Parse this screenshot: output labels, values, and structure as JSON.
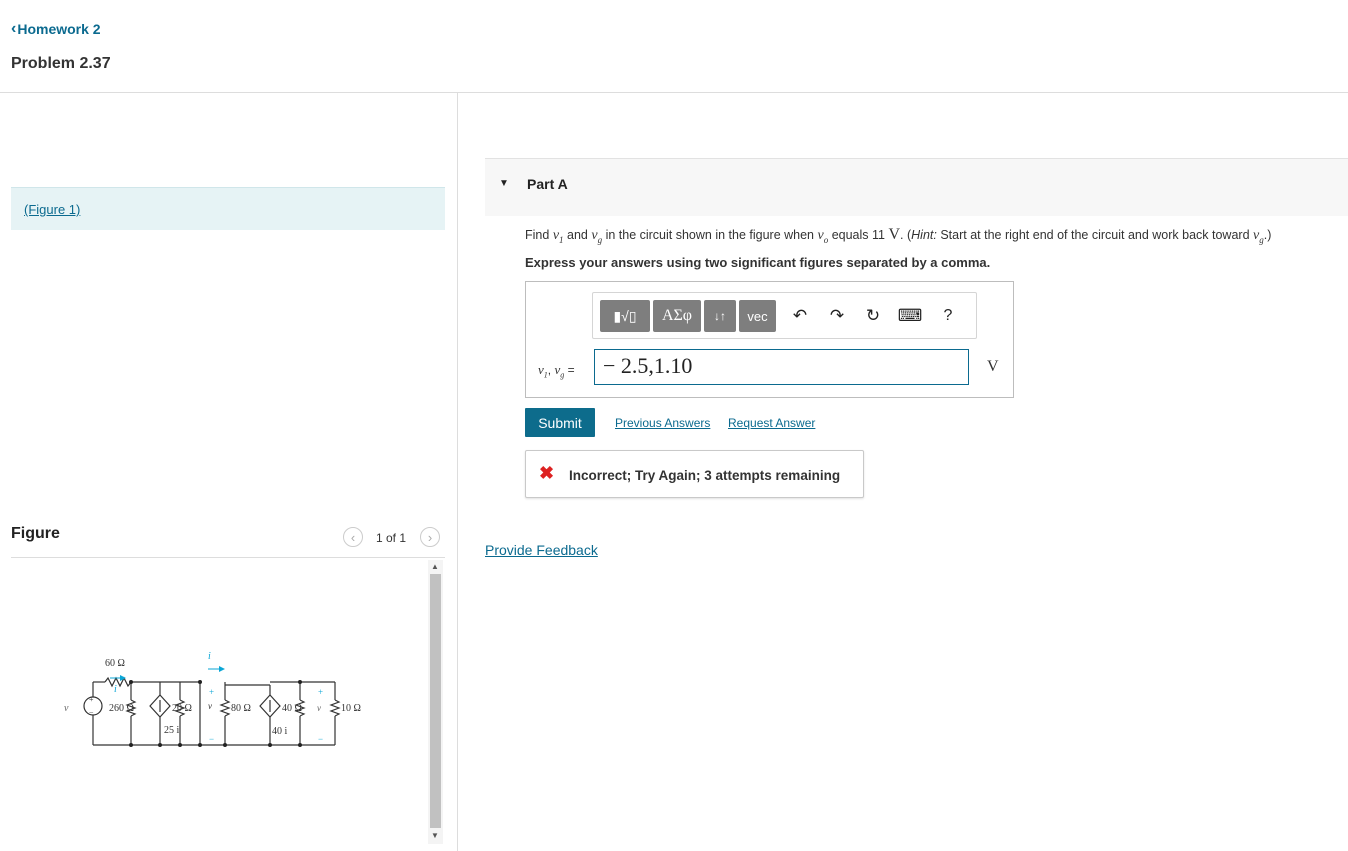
{
  "nav": {
    "back_label": "Homework 2"
  },
  "problem": {
    "title": "Problem 2.37"
  },
  "figure_panel": {
    "link_label": "(Figure 1)",
    "heading": "Figure",
    "pager": "1 of 1"
  },
  "circuit_labels": {
    "vg": "v",
    "r60": "60 Ω",
    "i1": "i",
    "i2": "i",
    "r260": "260 Ω",
    "r20": "20 Ω",
    "src1": "25 i",
    "v1": "v",
    "r80": "80 Ω",
    "r40": "40 Ω",
    "src2": "40 i",
    "vo": "v",
    "r10": "10 Ω",
    "plus": "+",
    "minus": "−"
  },
  "part_a": {
    "label": "Part A",
    "question": {
      "find": "Find",
      "v1": "v",
      "and": "and",
      "vg": "v",
      "middle": "in the circuit shown in the figure when",
      "vo": "v",
      "equals": "equals 11",
      "unit": "V",
      "hint_open": ". (",
      "hint_label": "Hint:",
      "hint_text": "Start at the right end of the circuit and work back toward",
      "hint_close": ".)"
    },
    "instruction": "Express your answers using two significant figures separated by a comma.",
    "toolbar": {
      "templates": "▮√▯",
      "greek": "ΑΣφ",
      "arrows": "↓↑",
      "vec": "vec",
      "undo": "↶",
      "redo": "↷",
      "reset": "↻",
      "keyboard": "⌨",
      "help": "?"
    },
    "answer_label": {
      "v1": "v",
      "sep": ", ",
      "vg": "v",
      "eq": " ="
    },
    "answer_value": "− 2.5,1.10",
    "answer_unit": "V",
    "submit_label": "Submit",
    "previous_answers_label": "Previous Answers",
    "request_answer_label": "Request Answer",
    "feedback": {
      "icon": "error-x-icon",
      "text": "Incorrect; Try Again; 3 attempts remaining"
    }
  },
  "provide_feedback_label": "Provide Feedback",
  "colors": {
    "link": "#0b6a8f",
    "submit": "#0d6c8c",
    "error": "#dd2222",
    "figure_band": "#e6f3f5"
  }
}
